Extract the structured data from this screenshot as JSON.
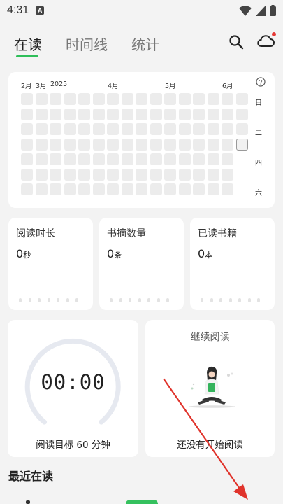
{
  "status_bar": {
    "time": "4:31",
    "badge": "A"
  },
  "tabs": [
    {
      "label": "在读",
      "active": true
    },
    {
      "label": "时间线",
      "active": false
    },
    {
      "label": "统计",
      "active": false
    }
  ],
  "heatmap": {
    "months": [
      "2月",
      "3月",
      "2025",
      "4月",
      "5月",
      "6月"
    ],
    "day_labels": [
      "日",
      "二",
      "四",
      "六"
    ]
  },
  "stats": [
    {
      "title": "阅读时长",
      "value": "0",
      "unit": "秒"
    },
    {
      "title": "书摘数量",
      "value": "0",
      "unit": "条"
    },
    {
      "title": "已读书籍",
      "value": "0",
      "unit": "本"
    }
  ],
  "timer": {
    "display": "00:00",
    "goal": "阅读目标 60 分钟"
  },
  "continue_reading": {
    "title": "继续阅读",
    "empty_text": "还没有开始阅读"
  },
  "recent": {
    "title": "最近在读"
  },
  "colors": {
    "accent": "#2fbf5a",
    "arrow": "#e0332b",
    "cell": "#ececec"
  }
}
